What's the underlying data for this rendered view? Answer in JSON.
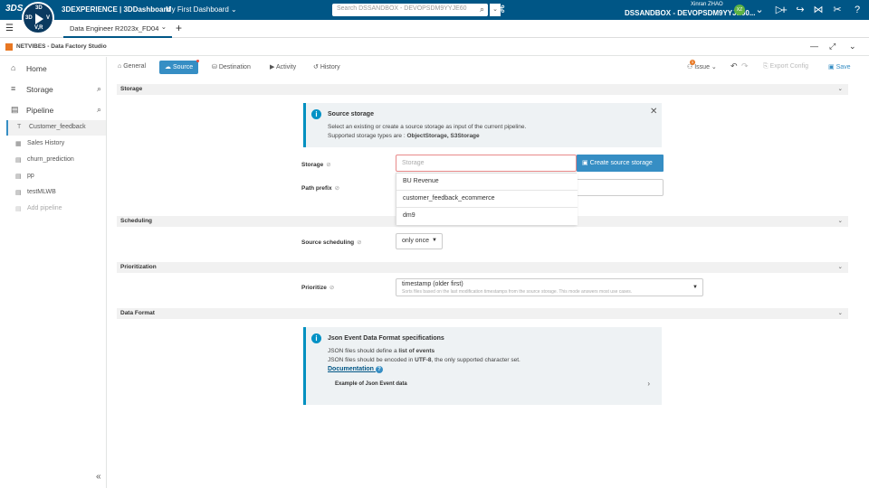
{
  "topbar": {
    "brand": "3DEXPERIENCE | 3DDashboard",
    "dashboard": "My First Dashboard",
    "search_placeholder": "Search DSSANDBOX - DEVOPSDM9YYJE60",
    "user_name": "Xinran ZHAO",
    "tenant": "DSSANDBOX - DEVOPSDM9YYJE60...",
    "avatar_initials": "XZ",
    "compass": {
      "top": "3D",
      "left": "3D",
      "right": "V",
      "bottom": "V,R"
    }
  },
  "tabrow": {
    "active_tab": "Data Engineer R2023x_FD04"
  },
  "app": {
    "title": "NETVIBES - Data Factory Studio"
  },
  "sidebar": {
    "home": "Home",
    "storage": "Storage",
    "pipeline": "Pipeline",
    "pipelines": [
      {
        "label": "Customer_feedback",
        "icon": "T"
      },
      {
        "label": "Sales History",
        "icon": "▦"
      },
      {
        "label": "churn_prediction",
        "icon": "▤"
      },
      {
        "label": "pp",
        "icon": "▤"
      },
      {
        "label": "testMLWB",
        "icon": "▤"
      },
      {
        "label": "Add pipeline",
        "icon": "▤"
      }
    ],
    "collapse": "«"
  },
  "tabs": {
    "general": "General",
    "source": "Source",
    "destination": "Destination",
    "activity": "Activity",
    "history": "History",
    "issue": "Issue",
    "issue_count": "1",
    "export": "Export Config",
    "save": "Save"
  },
  "sections": {
    "storage": "Storage",
    "scheduling": "Scheduling",
    "prioritization": "Prioritization",
    "data_format": "Data Format"
  },
  "source_info": {
    "title": "Source storage",
    "line1": "Select an existing or create a source storage as input of the current pipeline.",
    "line2_prefix": "Supported storage types are : ",
    "line2_bold": "ObjectStorage, S3Storage"
  },
  "form": {
    "storage_label": "Storage",
    "storage_placeholder": "Storage",
    "create_button": "Create source storage",
    "path_prefix_label": "Path prefix",
    "storage_options": [
      "BU Revenue",
      "customer_feedback_ecommerce",
      "dm9"
    ],
    "scheduling_label": "Source scheduling",
    "scheduling_value": "only once",
    "prioritize_label": "Prioritize",
    "prioritize_value": "timestamp (older first)",
    "prioritize_help": "Sorts files based on the last modification timestamps from the source storage. This mode answers most use cases."
  },
  "json_info": {
    "title": "Json Event Data Format specifications",
    "line1_prefix": "JSON files should define a ",
    "line1_bold": "list of events",
    "line2_prefix": "JSON files should be encoded in ",
    "line2_bold": "UTF-8",
    "line2_suffix": ", the only supported character set.",
    "doc_link": "Documentation",
    "example": "Example of Json Event data"
  }
}
